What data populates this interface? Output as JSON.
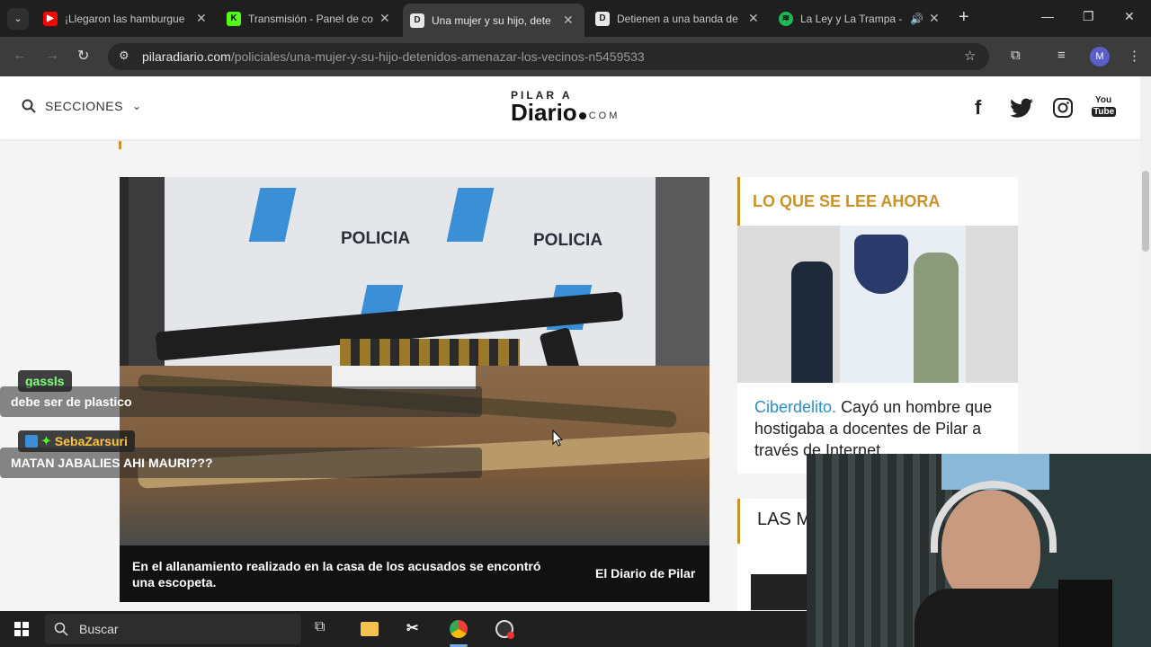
{
  "browser": {
    "tabs": [
      {
        "title": "¡Llegaron las hamburgue",
        "favicon": "youtube-icon",
        "color": "#ff0000",
        "active": false
      },
      {
        "title": "Transmisión - Panel de co",
        "favicon": "kick-icon",
        "color": "#53fc18",
        "active": false
      },
      {
        "title": "Una mujer y su hijo, dete",
        "favicon": "diario-icon",
        "color": "#e8e8e8",
        "active": true
      },
      {
        "title": "Detienen a una banda de",
        "favicon": "diario-icon",
        "color": "#e8e8e8",
        "active": false
      },
      {
        "title": "La Ley y La Trampa -",
        "favicon": "spotify-icon",
        "color": "#1db954",
        "active": false
      }
    ],
    "url_host": "pilaradiario.com",
    "url_path": "/policiales/una-mujer-y-su-hijo-detenidos-amenazar-los-vecinos-n5459533",
    "profile_initial": "M"
  },
  "site": {
    "sections_label": "SECCIONES",
    "logo_top": "PILAR A",
    "logo_main": "Diario",
    "logo_suffix": "COM",
    "accent": "#c8922a"
  },
  "article": {
    "image_caption": "En el allanamiento realizado en la casa de los acusados se encontró una escopeta.",
    "image_credit": "El Diario de Pilar",
    "police_text_1": "POLICIA",
    "police_text_2": "POLICIA"
  },
  "sidebar": {
    "section_title": "LO QUE SE LEE AHORA",
    "story_tag": "Ciberdelito.",
    "story_title": "Cayó un hombre que hostigaba a docentes de Pilar a través de Internet",
    "section2_title": "LAS M"
  },
  "chat": [
    {
      "user": "gassls",
      "user_color": "#7fff7f",
      "message": "debe ser de plastico"
    },
    {
      "user": "SebaZarsuri",
      "user_color": "#ffc440",
      "message": "MATAN JABALIES AHI MAURI???"
    }
  ],
  "taskbar": {
    "search_placeholder": "Buscar"
  }
}
